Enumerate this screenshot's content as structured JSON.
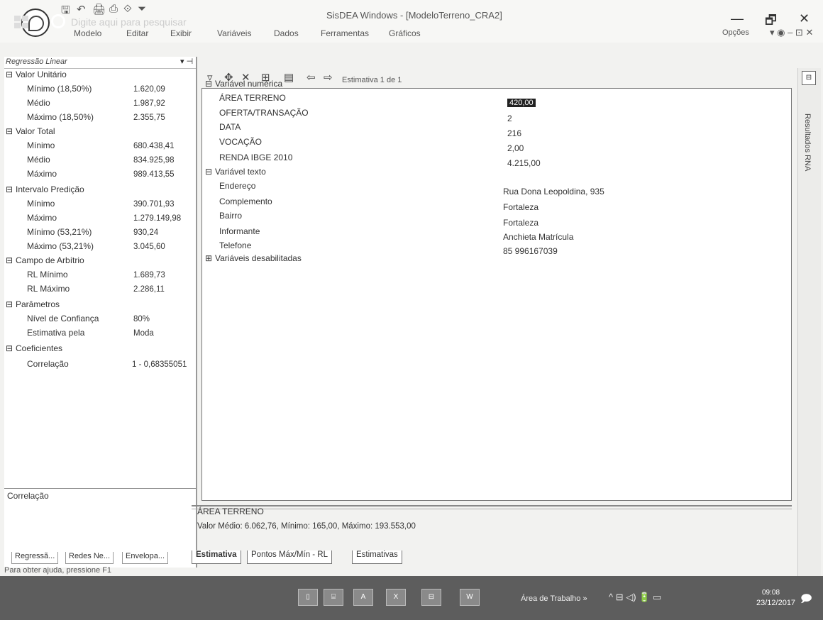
{
  "window": {
    "title": "SisDEA Windows - [ModeloTerreno_CRA2]",
    "controls": {
      "minimize": "—",
      "restore": "🗗",
      "close": "✕"
    },
    "quick_access": [
      "🖫",
      "↶",
      "🖨",
      "⎙",
      "⟐",
      "⏷"
    ]
  },
  "menu": [
    "Modelo",
    "Editar",
    "Exibir",
    "Variáveis",
    "Dados",
    "Ferramentas",
    "Gráficos"
  ],
  "ribbon": {
    "options": "Opções",
    "ctrls": "▾ ◉ – ⊡ ✕"
  },
  "left_panel": {
    "header": "Regressão Linear",
    "header_dropdown": "▾ ⊣",
    "sections": [
      {
        "title": "Valor Unitário",
        "toggle": "⊟",
        "rows": [
          {
            "label": "Mínimo (18,50%)",
            "value": "1.620,09"
          },
          {
            "label": "Médio",
            "value": "1.987,92"
          },
          {
            "label": "Máximo (18,50%)",
            "value": "2.355,75"
          }
        ]
      },
      {
        "title": "Valor Total",
        "toggle": "⊟",
        "rows": [
          {
            "label": "Mínimo",
            "value": "680.438,41"
          },
          {
            "label": "Médio",
            "value": "834.925,98"
          },
          {
            "label": "Máximo",
            "value": "989.413,55"
          }
        ]
      },
      {
        "title": "Intervalo Predição",
        "toggle": "⊟",
        "rows": [
          {
            "label": "Mínimo",
            "value": "390.701,93"
          },
          {
            "label": "Máximo",
            "value": "1.279.149,98"
          },
          {
            "label": "Mínimo (53,21%)",
            "value": "930,24"
          },
          {
            "label": "Máximo (53,21%)",
            "value": "3.045,60"
          }
        ]
      },
      {
        "title": "Campo de Arbítrio",
        "toggle": "⊟",
        "rows": [
          {
            "label": "RL Mínimo",
            "value": "1.689,73"
          },
          {
            "label": "RL Máximo",
            "value": "2.286,11"
          }
        ]
      },
      {
        "title": "Parâmetros",
        "toggle": "⊟",
        "rows": [
          {
            "label": "Nível de Confiança",
            "value": "80%"
          },
          {
            "label": "Estimativa pela",
            "value": "Moda"
          }
        ]
      },
      {
        "title": "Coeficientes",
        "toggle": "⊟",
        "rows": [
          {
            "label": "Correlação",
            "value": "1 - 0,68355051"
          }
        ]
      }
    ],
    "correlacao_title": "Correlação",
    "tabs": [
      "Regressã...",
      "Redes Ne...",
      "Envelopa..."
    ]
  },
  "toolbar": {
    "buttons": [
      "▿",
      "✥",
      "✕",
      "⊞",
      "▤",
      "⇦",
      "⇨"
    ],
    "estimativa_label": "Estimativa 1 de 1"
  },
  "main": {
    "numeric_section": {
      "toggle": "⊟",
      "title": "Variável numérica"
    },
    "numeric_rows": [
      {
        "label": "ÁREA TERRENO",
        "value": "420,00"
      },
      {
        "label": "OFERTA/TRANSAÇÃO",
        "value": "2"
      },
      {
        "label": "DATA",
        "value": "216"
      },
      {
        "label": "VOCAÇÃO",
        "value": "2,00"
      },
      {
        "label": "RENDA IBGE 2010",
        "value": "4.215,00"
      }
    ],
    "text_section": {
      "toggle": "⊟",
      "title": "Variável texto"
    },
    "text_rows": [
      {
        "label": "Endereço",
        "value": "Rua Dona Leopoldina, 935"
      },
      {
        "label": "Complemento",
        "value": "Fortaleza"
      },
      {
        "label": "Bairro",
        "value": "Fortaleza"
      },
      {
        "label": "Informante",
        "value": "Anchieta Matrícula"
      },
      {
        "label": "Telefone",
        "value": "85 996167039"
      }
    ],
    "disabled_section": {
      "toggle": "⊞",
      "title": "Variáveis desabilitadas"
    }
  },
  "info": {
    "title": "ÁREA TERRENO",
    "text": "Valor Médio: 6.062,76, Mínimo: 165,00, Máximo: 193.553,00"
  },
  "bottom_tabs": [
    "Estimativa",
    "Pontos Máx/Mín - RL",
    "Estimativas"
  ],
  "right_dock": {
    "label": "Resultados RNA",
    "top_icon": "⊟"
  },
  "status": "Para obter ajuda, pressione F1",
  "taskbar": {
    "search_placeholder": "Digite aqui para pesquisar",
    "apps": [
      "▯",
      "⌸",
      "A",
      "X",
      "⊟",
      "W"
    ],
    "tray_label": "Área de Trabalho »",
    "tray_icons": "^ ⊟ ◁) 🔋 ▭",
    "time": "09:08",
    "date": "23/12/2017",
    "notification": "🗩"
  },
  "colors": {
    "taskbar": "#5d5d5d",
    "highlight": "#222222",
    "panel": "#ffffff"
  }
}
